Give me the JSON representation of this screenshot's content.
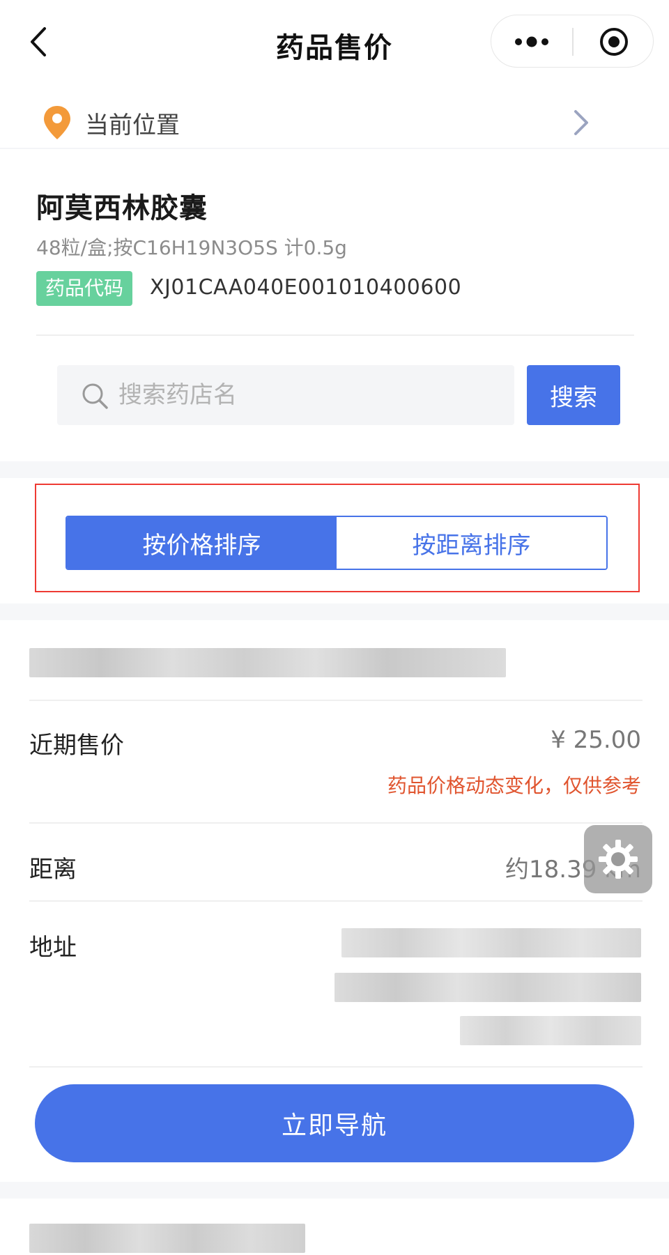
{
  "nav": {
    "title": "药品售价",
    "back_icon": "chevron-left-icon",
    "menu_icon": "more-dots-icon",
    "close_icon": "target-close-icon"
  },
  "location": {
    "label": "当前位置",
    "icon": "location-pin-icon",
    "arrow_icon": "chevron-right-icon",
    "icon_color": "#f39a3a"
  },
  "drug": {
    "name": "阿莫西林胶囊",
    "spec": "48粒/盒;按C16H19N3O5S 计0.5g",
    "code_label": "药品代码",
    "code": "XJ01CAA040E001010400600"
  },
  "search": {
    "placeholder": "搜索药店名",
    "value": "",
    "button_label": "搜索",
    "icon": "search-icon"
  },
  "sort": {
    "options": [
      {
        "label": "按价格排序",
        "active": true
      },
      {
        "label": "按距离排序",
        "active": false
      }
    ],
    "accent": "#4773e8"
  },
  "pharmacy_card": {
    "price_label": "近期售价",
    "price_value": "¥ 25.00",
    "price_note": "药品价格动态变化，仅供参考",
    "distance_label": "距离",
    "distance_value": "约18.39 km",
    "address_label": "地址",
    "navigate_label": "立即导航"
  },
  "floating_button": {
    "icon": "gear-icon"
  },
  "colors": {
    "primary": "#4773e8",
    "tag_green": "#67d19d",
    "warning": "#e0542e",
    "highlight_border": "#ee3a33"
  }
}
